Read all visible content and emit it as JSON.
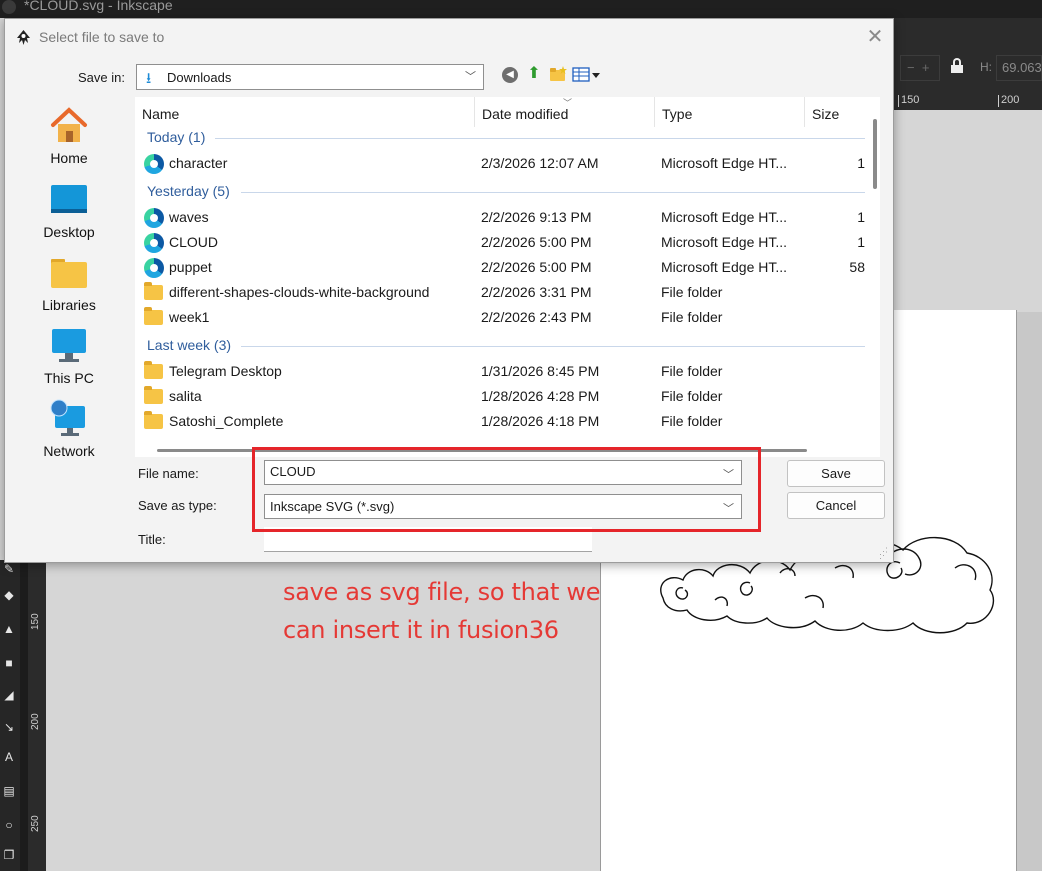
{
  "app": {
    "window_title": "*CLOUD.svg - Inkscape",
    "toolbar": {
      "minus": "−",
      "plus": "+",
      "h_label": "H:",
      "h_value": "69.063"
    },
    "ruler_top": [
      "150",
      "200"
    ],
    "ruler_left": [
      "150",
      "200",
      "250"
    ]
  },
  "dialog": {
    "title": "Select file to save to",
    "close": "✕",
    "save_in_label": "Save in:",
    "save_in_value": "Downloads",
    "places": [
      {
        "label": "Home",
        "icon": "home-icon"
      },
      {
        "label": "Desktop",
        "icon": "desktop-icon"
      },
      {
        "label": "Libraries",
        "icon": "libraries-icon"
      },
      {
        "label": "This PC",
        "icon": "computer-icon"
      },
      {
        "label": "Network",
        "icon": "network-icon"
      }
    ],
    "columns": [
      "Name",
      "Date modified",
      "Type",
      "Size"
    ],
    "groups": [
      {
        "label": "Today (1)"
      },
      {
        "label": "Yesterday (5)"
      },
      {
        "label": "Last week (3)"
      }
    ],
    "rows": [
      {
        "name": "character",
        "date": "2/3/2026 12:07 AM",
        "type": "Microsoft Edge HT...",
        "size": "1",
        "icon": "edge-html-icon"
      },
      {
        "name": "waves",
        "date": "2/2/2026 9:13 PM",
        "type": "Microsoft Edge HT...",
        "size": "1",
        "icon": "edge-html-icon"
      },
      {
        "name": "CLOUD",
        "date": "2/2/2026 5:00 PM",
        "type": "Microsoft Edge HT...",
        "size": "1",
        "icon": "edge-html-icon"
      },
      {
        "name": "puppet",
        "date": "2/2/2026 5:00 PM",
        "type": "Microsoft Edge HT...",
        "size": "58",
        "icon": "edge-html-icon"
      },
      {
        "name": "different-shapes-clouds-white-background",
        "date": "2/2/2026 3:31 PM",
        "type": "File folder",
        "size": "",
        "icon": "folder-icon"
      },
      {
        "name": "week1",
        "date": "2/2/2026 2:43 PM",
        "type": "File folder",
        "size": "",
        "icon": "folder-icon"
      },
      {
        "name": "Telegram Desktop",
        "date": "1/31/2026 8:45 PM",
        "type": "File folder",
        "size": "",
        "icon": "folder-icon"
      },
      {
        "name": "salita",
        "date": "1/28/2026 4:28 PM",
        "type": "File folder",
        "size": "",
        "icon": "folder-icon"
      },
      {
        "name": "Satoshi_Complete",
        "date": "1/28/2026 4:18 PM",
        "type": "File folder",
        "size": "",
        "icon": "folder-icon"
      }
    ],
    "file_name_label": "File name:",
    "file_name_value": "CLOUD",
    "save_as_type_label": "Save as type:",
    "save_as_type_value": "Inkscape SVG (*.svg)",
    "title_label": "Title:",
    "title_value": "",
    "save_button": "Save",
    "cancel_button": "Cancel"
  },
  "annotation": {
    "line1": "save as svg file, so that we",
    "line2": "can insert it in fusion36",
    "color": "#e53935"
  },
  "colors": {
    "highlight_box": "#e5252a",
    "group_header": "#2f5d9c"
  }
}
